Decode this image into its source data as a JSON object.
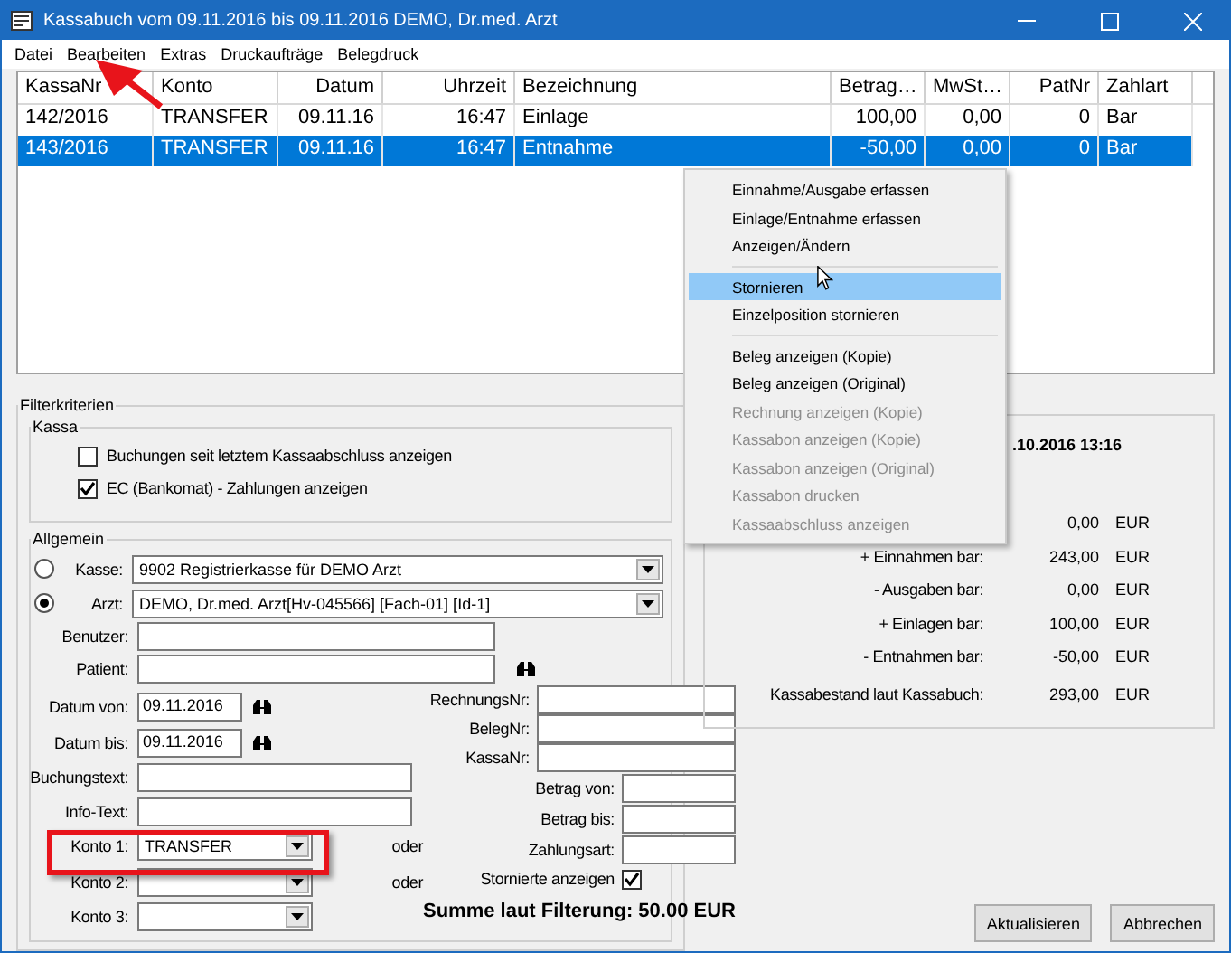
{
  "window": {
    "title": "Kassabuch vom 09.11.2016 bis 09.11.2016 DEMO, Dr.med. Arzt"
  },
  "menu": [
    "Datei",
    "Bearbeiten",
    "Extras",
    "Druckaufträge",
    "Belegdruck"
  ],
  "table": {
    "columns": [
      "KassaNr",
      "Konto",
      "Datum",
      "Uhrzeit",
      "Bezeichnung",
      "Betrag…",
      "MwSt…",
      "PatNr",
      "Zahlart"
    ],
    "rows": [
      {
        "selected": false,
        "cells": [
          "142/2016",
          "TRANSFER",
          "09.11.16",
          "16:47",
          "Einlage",
          "100,00",
          "0,00",
          "0",
          "Bar"
        ]
      },
      {
        "selected": true,
        "cells": [
          "143/2016",
          "TRANSFER",
          "09.11.16",
          "16:47",
          "Entnahme",
          "-50,00",
          "0,00",
          "0",
          "Bar"
        ]
      }
    ]
  },
  "context_menu": [
    {
      "kind": "item",
      "label": "Einnahme/Ausgabe erfassen",
      "disabled": false,
      "selected": false
    },
    {
      "kind": "item",
      "label": "Einlage/Entnahme erfassen",
      "disabled": false,
      "selected": false
    },
    {
      "kind": "item",
      "label": "Anzeigen/Ändern",
      "disabled": false,
      "selected": false
    },
    {
      "kind": "separator"
    },
    {
      "kind": "item",
      "label": "Stornieren",
      "disabled": false,
      "selected": true
    },
    {
      "kind": "item",
      "label": "Einzelposition stornieren",
      "disabled": false,
      "selected": false
    },
    {
      "kind": "separator"
    },
    {
      "kind": "item",
      "label": "Beleg anzeigen (Kopie)",
      "disabled": false,
      "selected": false
    },
    {
      "kind": "item",
      "label": "Beleg anzeigen (Original)",
      "disabled": false,
      "selected": false
    },
    {
      "kind": "item",
      "label": "Rechnung anzeigen (Kopie)",
      "disabled": true,
      "selected": false
    },
    {
      "kind": "item",
      "label": "Kassabon anzeigen (Kopie)",
      "disabled": true,
      "selected": false
    },
    {
      "kind": "item",
      "label": "Kassabon anzeigen (Original)",
      "disabled": true,
      "selected": false
    },
    {
      "kind": "item",
      "label": "Kassabon drucken",
      "disabled": true,
      "selected": false
    },
    {
      "kind": "item",
      "label": "Kassaabschluss anzeigen",
      "disabled": true,
      "selected": false
    }
  ],
  "filter": {
    "title": "Filterkriterien",
    "kassa": {
      "title": "Kassa",
      "options": [
        {
          "label": "Buchungen seit letztem Kassaabschluss anzeigen",
          "checked": false
        },
        {
          "label": "EC (Bankomat) - Zahlungen anzeigen",
          "checked": true
        }
      ]
    },
    "allgemein": {
      "title": "Allgemein",
      "sources": [
        {
          "label": "Kasse:",
          "selected": false,
          "value": "9902  Registrierkasse für DEMO Arzt"
        },
        {
          "label": "Arzt:",
          "selected": true,
          "value": "DEMO, Dr.med. Arzt[Hv-045566] [Fach-01] [Id-1]"
        }
      ],
      "fields": [
        {
          "label": "Benutzer:",
          "search": false
        },
        {
          "label": "Patient:",
          "search": true
        }
      ],
      "left": [
        {
          "kind": "date",
          "label": "Datum von:",
          "value": "09.11.2016"
        },
        {
          "kind": "date",
          "label": "Datum bis:",
          "value": "09.11.2016"
        },
        {
          "kind": "text",
          "label": "Buchungstext:"
        },
        {
          "kind": "text",
          "label": "Info-Text:"
        },
        {
          "kind": "combo",
          "label": "Konto 1:",
          "value": "TRANSFER",
          "suffix": "oder"
        },
        {
          "kind": "combo",
          "label": "Konto 2:",
          "suffix": "oder"
        },
        {
          "kind": "combo",
          "label": "Konto 3:"
        }
      ],
      "right": [
        {
          "kind": "wide",
          "label": "RechnungsNr:"
        },
        {
          "kind": "wide",
          "label": "BelegNr:"
        },
        {
          "kind": "wide",
          "label": "KassaNr:"
        },
        {
          "kind": "narrow",
          "label": "Betrag von:"
        },
        {
          "kind": "narrow",
          "label": "Betrag bis:"
        },
        {
          "kind": "narrow",
          "label": "Zahlungsart:"
        },
        {
          "kind": "check",
          "label": "Stornierte anzeigen",
          "checked": true
        }
      ],
      "sum": "Summe laut Filterung: 50.00 EUR"
    }
  },
  "summary": {
    "header": ".10.2016 13:16",
    "rows": [
      {
        "value": "0,00",
        "unit": "EUR"
      },
      {
        "label": "+ Einnahmen bar:",
        "value": "243,00",
        "unit": "EUR"
      },
      {
        "label": "- Ausgaben bar:",
        "value": "0,00",
        "unit": "EUR"
      },
      {
        "label": "+ Einlagen bar:",
        "value": "100,00",
        "unit": "EUR"
      },
      {
        "label": "- Entnahmen bar:",
        "value": "-50,00",
        "unit": "EUR"
      },
      {
        "label": "Kassabestand laut Kassabuch:",
        "value": "293,00",
        "unit": "EUR"
      }
    ]
  },
  "buttons": [
    "Aktualisieren",
    "Abbrechen"
  ]
}
